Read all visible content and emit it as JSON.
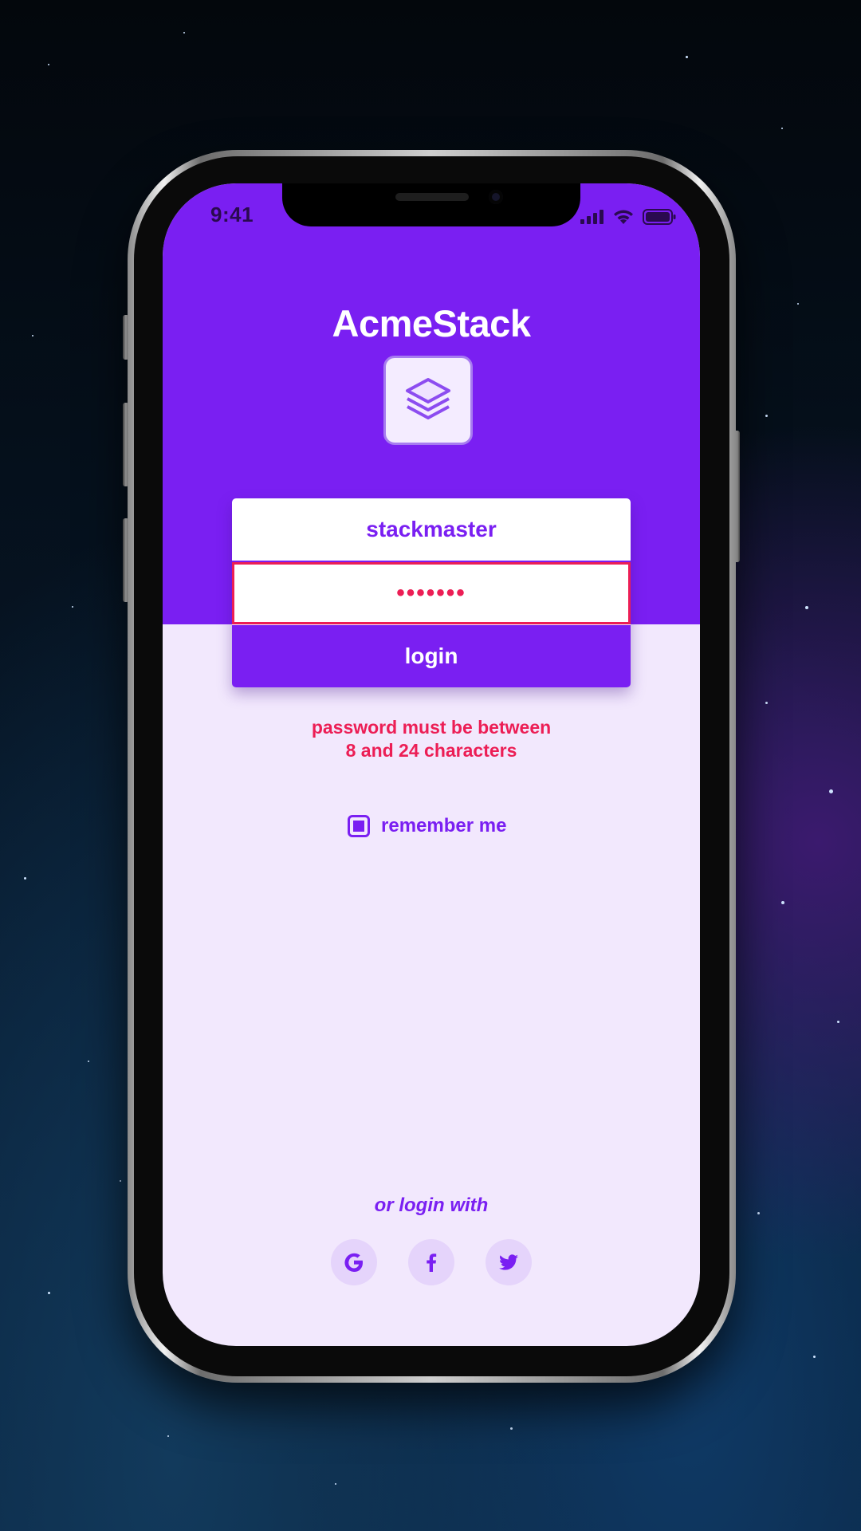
{
  "status_bar": {
    "time": "9:41"
  },
  "app": {
    "title": "AcmeStack"
  },
  "login_form": {
    "username_value": "stackmaster",
    "password_value": "•••••••",
    "login_label": "login",
    "error_message_line1": "password must be between",
    "error_message_line2": "8 and 24 characters"
  },
  "remember_me": {
    "label": "remember me",
    "checked": true
  },
  "social_login": {
    "prompt": "or login with",
    "providers": [
      "google-icon",
      "facebook-icon",
      "twitter-icon"
    ]
  },
  "colors": {
    "primary": "#7a1ff2",
    "error": "#ec1e55",
    "background_light": "#f2e8fd",
    "social_bg": "#e5d4fb"
  }
}
